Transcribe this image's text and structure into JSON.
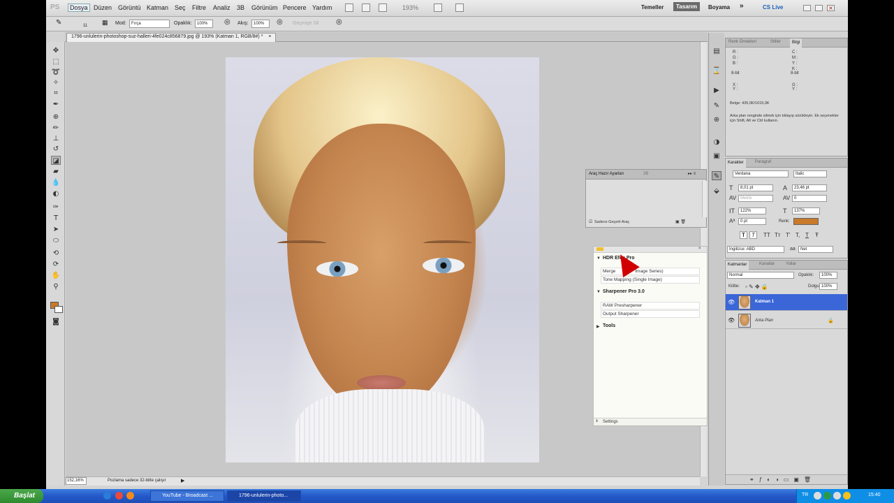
{
  "menubar": {
    "logo": "PS",
    "items": [
      "Dosya",
      "Düzen",
      "Görüntü",
      "Katman",
      "Seç",
      "Filtre",
      "Analiz",
      "3B",
      "Görünüm",
      "Pencere",
      "Yardım"
    ],
    "zoom": "193%",
    "workspaces": [
      "Temeller",
      "Tasarım",
      "Boyama"
    ],
    "overflow": "»",
    "cslive": "CS Live"
  },
  "options": {
    "brush_size": "11",
    "mode_label": "Mod:",
    "mode_value": "Fırça",
    "opacity_label": "Opaklık:",
    "opacity_value": "100%",
    "flow_label": "Akış:",
    "flow_value": "100%",
    "erase_history": "Geçmişe Sil"
  },
  "document": {
    "tab_title": "1796-unlulerin-photoshop-suz-halleri-4fe024c856879.jpg @ 193% (Katman 1, RGB/8#) *",
    "status_zoom": "152,16%",
    "status_message": "Pozlama sadece 32-bitte çalışır"
  },
  "info_panel": {
    "tabs": [
      "Renk Örnekleri",
      "Stiller",
      "Bilgi"
    ],
    "rgb_labels": [
      "R :",
      "G :",
      "B :"
    ],
    "cmyk_labels": [
      "C :",
      "M :",
      "Y :",
      "K :"
    ],
    "bit_left": "8-bit",
    "bit_right": "8-bit",
    "xy_left": "X :\nY :",
    "wh_right": "G :\nY :",
    "doc_size": "Belge: 435,0K/1015,0K",
    "hint": "Arka plan renginde silmek için tıklayıp sürükleyin. Ek seçenekler için Shift, Alt ve Ctrl kullanın."
  },
  "character_panel": {
    "tabs": [
      "Karakter",
      "Paragraf"
    ],
    "font_family": "Verdana",
    "font_style": "Italic",
    "font_size": "8,01 pt",
    "leading": "23,46 pt",
    "kerning": "Metrik",
    "tracking": "0",
    "vscale": "122%",
    "hscale": "137%",
    "baseline": "0 pt",
    "color_label": "Renk:",
    "color_hex": "#c87a2a",
    "style_buttons": [
      "T",
      "T",
      "TT",
      "Tт",
      "T'",
      "T,",
      "T",
      "Ŧ"
    ],
    "language": "İngilizce: ABD",
    "antialias_label": "aa",
    "antialias": "Net"
  },
  "tool_presets": {
    "tabs": [
      "Araç Hazır Ayarları",
      "3B"
    ],
    "checkbox_label": "Sadece Geçerli Araç"
  },
  "plugin": {
    "groups": [
      {
        "title": "HDR Efex Pro",
        "items": [
          "Merge (Multi-Image Series)",
          "Tone Mapping (Single Image)"
        ]
      },
      {
        "title": "Sharpener Pro 3.0",
        "items": [
          "RAW Presharpener",
          "Output Sharpener"
        ]
      },
      {
        "title": "Tools",
        "items": []
      }
    ],
    "merge_visible": "Merge",
    "merge_tail": "Image Series)",
    "settings": "Settings"
  },
  "layers_panel": {
    "tabs": [
      "Katmanlar",
      "Kanallar",
      "Yollar"
    ],
    "blend_mode": "Normal",
    "opacity_label": "Opaklık:",
    "opacity": "100%",
    "lock_label": "Kilitle:",
    "fill_label": "Dolgu:",
    "fill": "100%",
    "layers": [
      {
        "name": "Katman 1",
        "selected": true
      },
      {
        "name": "Arka Plan",
        "selected": false
      }
    ],
    "selection_color": "#3a66d8"
  },
  "taskbar": {
    "start": "Başlat",
    "items": [
      "YouTube - Broadcast ...",
      "1796-unlulerin-photo..."
    ],
    "lang": "TR",
    "clock": "15:40"
  },
  "colors": {
    "foreground": "#c87a2a",
    "background": "#ffffff"
  }
}
